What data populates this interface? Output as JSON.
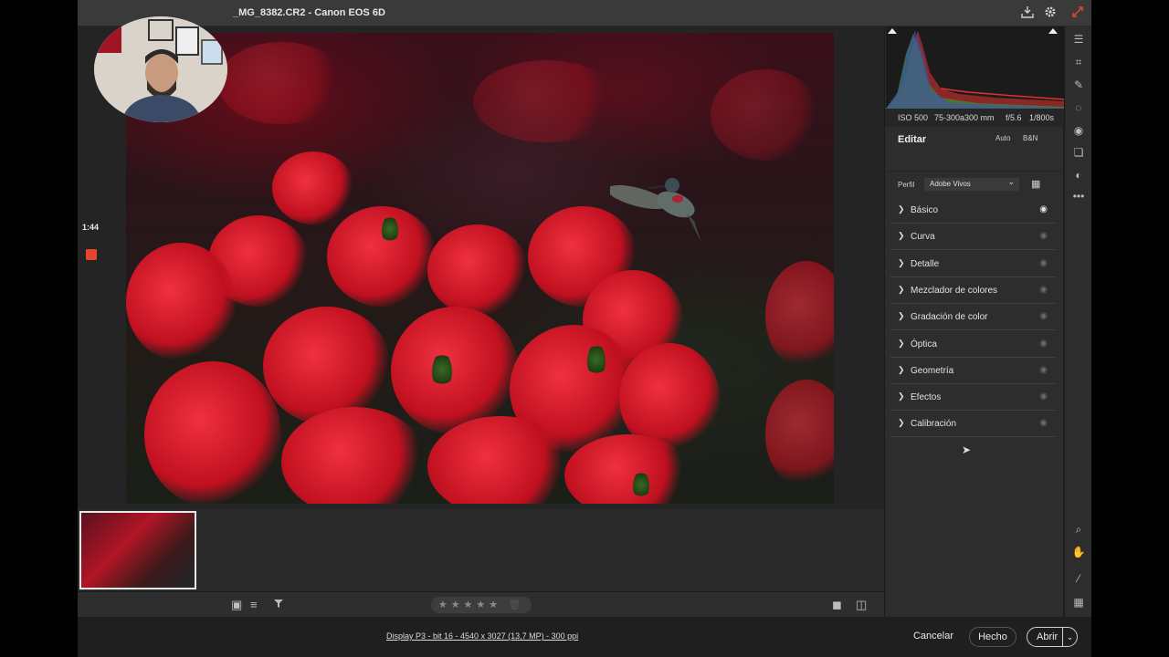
{
  "window": {
    "title": "_MG_8382.CR2 -  Canon EOS 6D"
  },
  "titlebar_icons": [
    "save-icon",
    "gear-icon",
    "expand-icon"
  ],
  "recording": {
    "time": "1:44"
  },
  "exif": {
    "iso": "ISO 500",
    "lens": "75-300a300 mm",
    "aperture": "f/5.6",
    "shutter": "1/800s"
  },
  "edit": {
    "title": "Editar",
    "auto_label": "Auto",
    "bw_label": "B&N",
    "profile_label": "Perfil",
    "profile_value": "Adobe Vivos"
  },
  "sections": [
    {
      "label": "Básico",
      "visible": true
    },
    {
      "label": "Curva",
      "visible": false
    },
    {
      "label": "Detalle",
      "visible": false
    },
    {
      "label": "Mezclador de colores",
      "visible": false
    },
    {
      "label": "Gradación de color",
      "visible": false
    },
    {
      "label": "Óptica",
      "visible": false
    },
    {
      "label": "Geometría",
      "visible": false
    },
    {
      "label": "Efectos",
      "visible": false
    },
    {
      "label": "Calibración",
      "visible": false
    }
  ],
  "rating": {
    "stars": "★★★★★",
    "value": 0
  },
  "status": {
    "file_info": "Display P3 - bit 16 - 4540 x 3027 (13,7 MP) - 300 ppi"
  },
  "buttons": {
    "cancel": "Cancelar",
    "done": "Hecho",
    "open": "Abrir"
  },
  "colors": {
    "accent": "#e8432e",
    "panel": "#2d2d2d",
    "background": "#1f1f1f"
  }
}
